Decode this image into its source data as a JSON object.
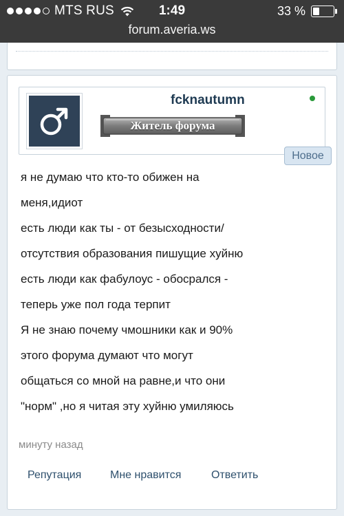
{
  "status_bar": {
    "carrier": "MTS RUS",
    "time": "1:49",
    "battery_percent_text": "33 %",
    "battery_level": 0.33,
    "signal_bars_filled": 4,
    "signal_bars_total": 5
  },
  "browser": {
    "url": "forum.averia.ws"
  },
  "post": {
    "author": {
      "username": "fcknautumn",
      "rank": "Житель форума",
      "online": true,
      "avatar_icon": "male-symbol-icon"
    },
    "badge": "Новое",
    "message_lines": [
      "я не думаю что кто-то обижен на",
      "меня,идиот",
      "есть люди как ты - от безысходности/",
      "отсутствия образования пишущие хуйню",
      "есть люди как фабулоус - обосрался -",
      "теперь уже пол года терпит",
      "Я не знаю почему чмошники как и 90%",
      "этого форума думают что могут",
      "общаться со мной на равне,и что они",
      "\"норм\" ,но я читая эту хуйню умиляюсь"
    ],
    "timestamp": "минуту назад",
    "actions": {
      "reputation": "Репутация",
      "like": "Мне нравится",
      "reply": "Ответить"
    }
  },
  "colors": {
    "page_background": "#e8eef3",
    "status_bar": "#3a3a3a",
    "username": "#1e3a52",
    "avatar_background": "#2f4257",
    "online_indicator": "#2a9a3a",
    "badge_background": "#d8e5f1",
    "link": "#2d4f6c"
  }
}
